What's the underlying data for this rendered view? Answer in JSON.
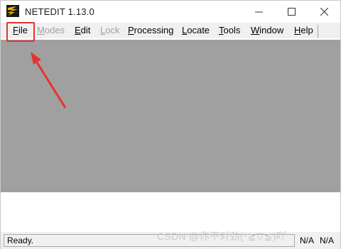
{
  "window": {
    "title": "NETEDIT 1.13.0",
    "icons": {
      "app": "netedit-logo-icon",
      "minimize": "minimize-icon",
      "maximize": "maximize-icon",
      "close": "close-icon"
    }
  },
  "menubar": {
    "items": [
      {
        "underline": "F",
        "rest": "ile",
        "enabled": true
      },
      {
        "underline": "M",
        "rest": "odes",
        "enabled": false
      },
      {
        "underline": "E",
        "rest": "dit",
        "enabled": true
      },
      {
        "underline": "L",
        "rest": "ock",
        "enabled": false
      },
      {
        "underline": "P",
        "rest": "rocessing",
        "enabled": true
      },
      {
        "underline": "L",
        "rest": "ocate",
        "enabled": true
      },
      {
        "underline": "T",
        "rest": "ools",
        "enabled": true
      },
      {
        "underline": "W",
        "rest": "indow",
        "enabled": true
      },
      {
        "underline": "H",
        "rest": "elp",
        "enabled": true
      }
    ]
  },
  "annotation": {
    "color": "#e8322f",
    "target": "File"
  },
  "canvas": {
    "background": "#a0a0a0"
  },
  "statusbar": {
    "text": "Ready.",
    "x": "N/A",
    "y": "N/A"
  },
  "watermark": "CSDN @你不对劲(*≧▽≦)吖"
}
